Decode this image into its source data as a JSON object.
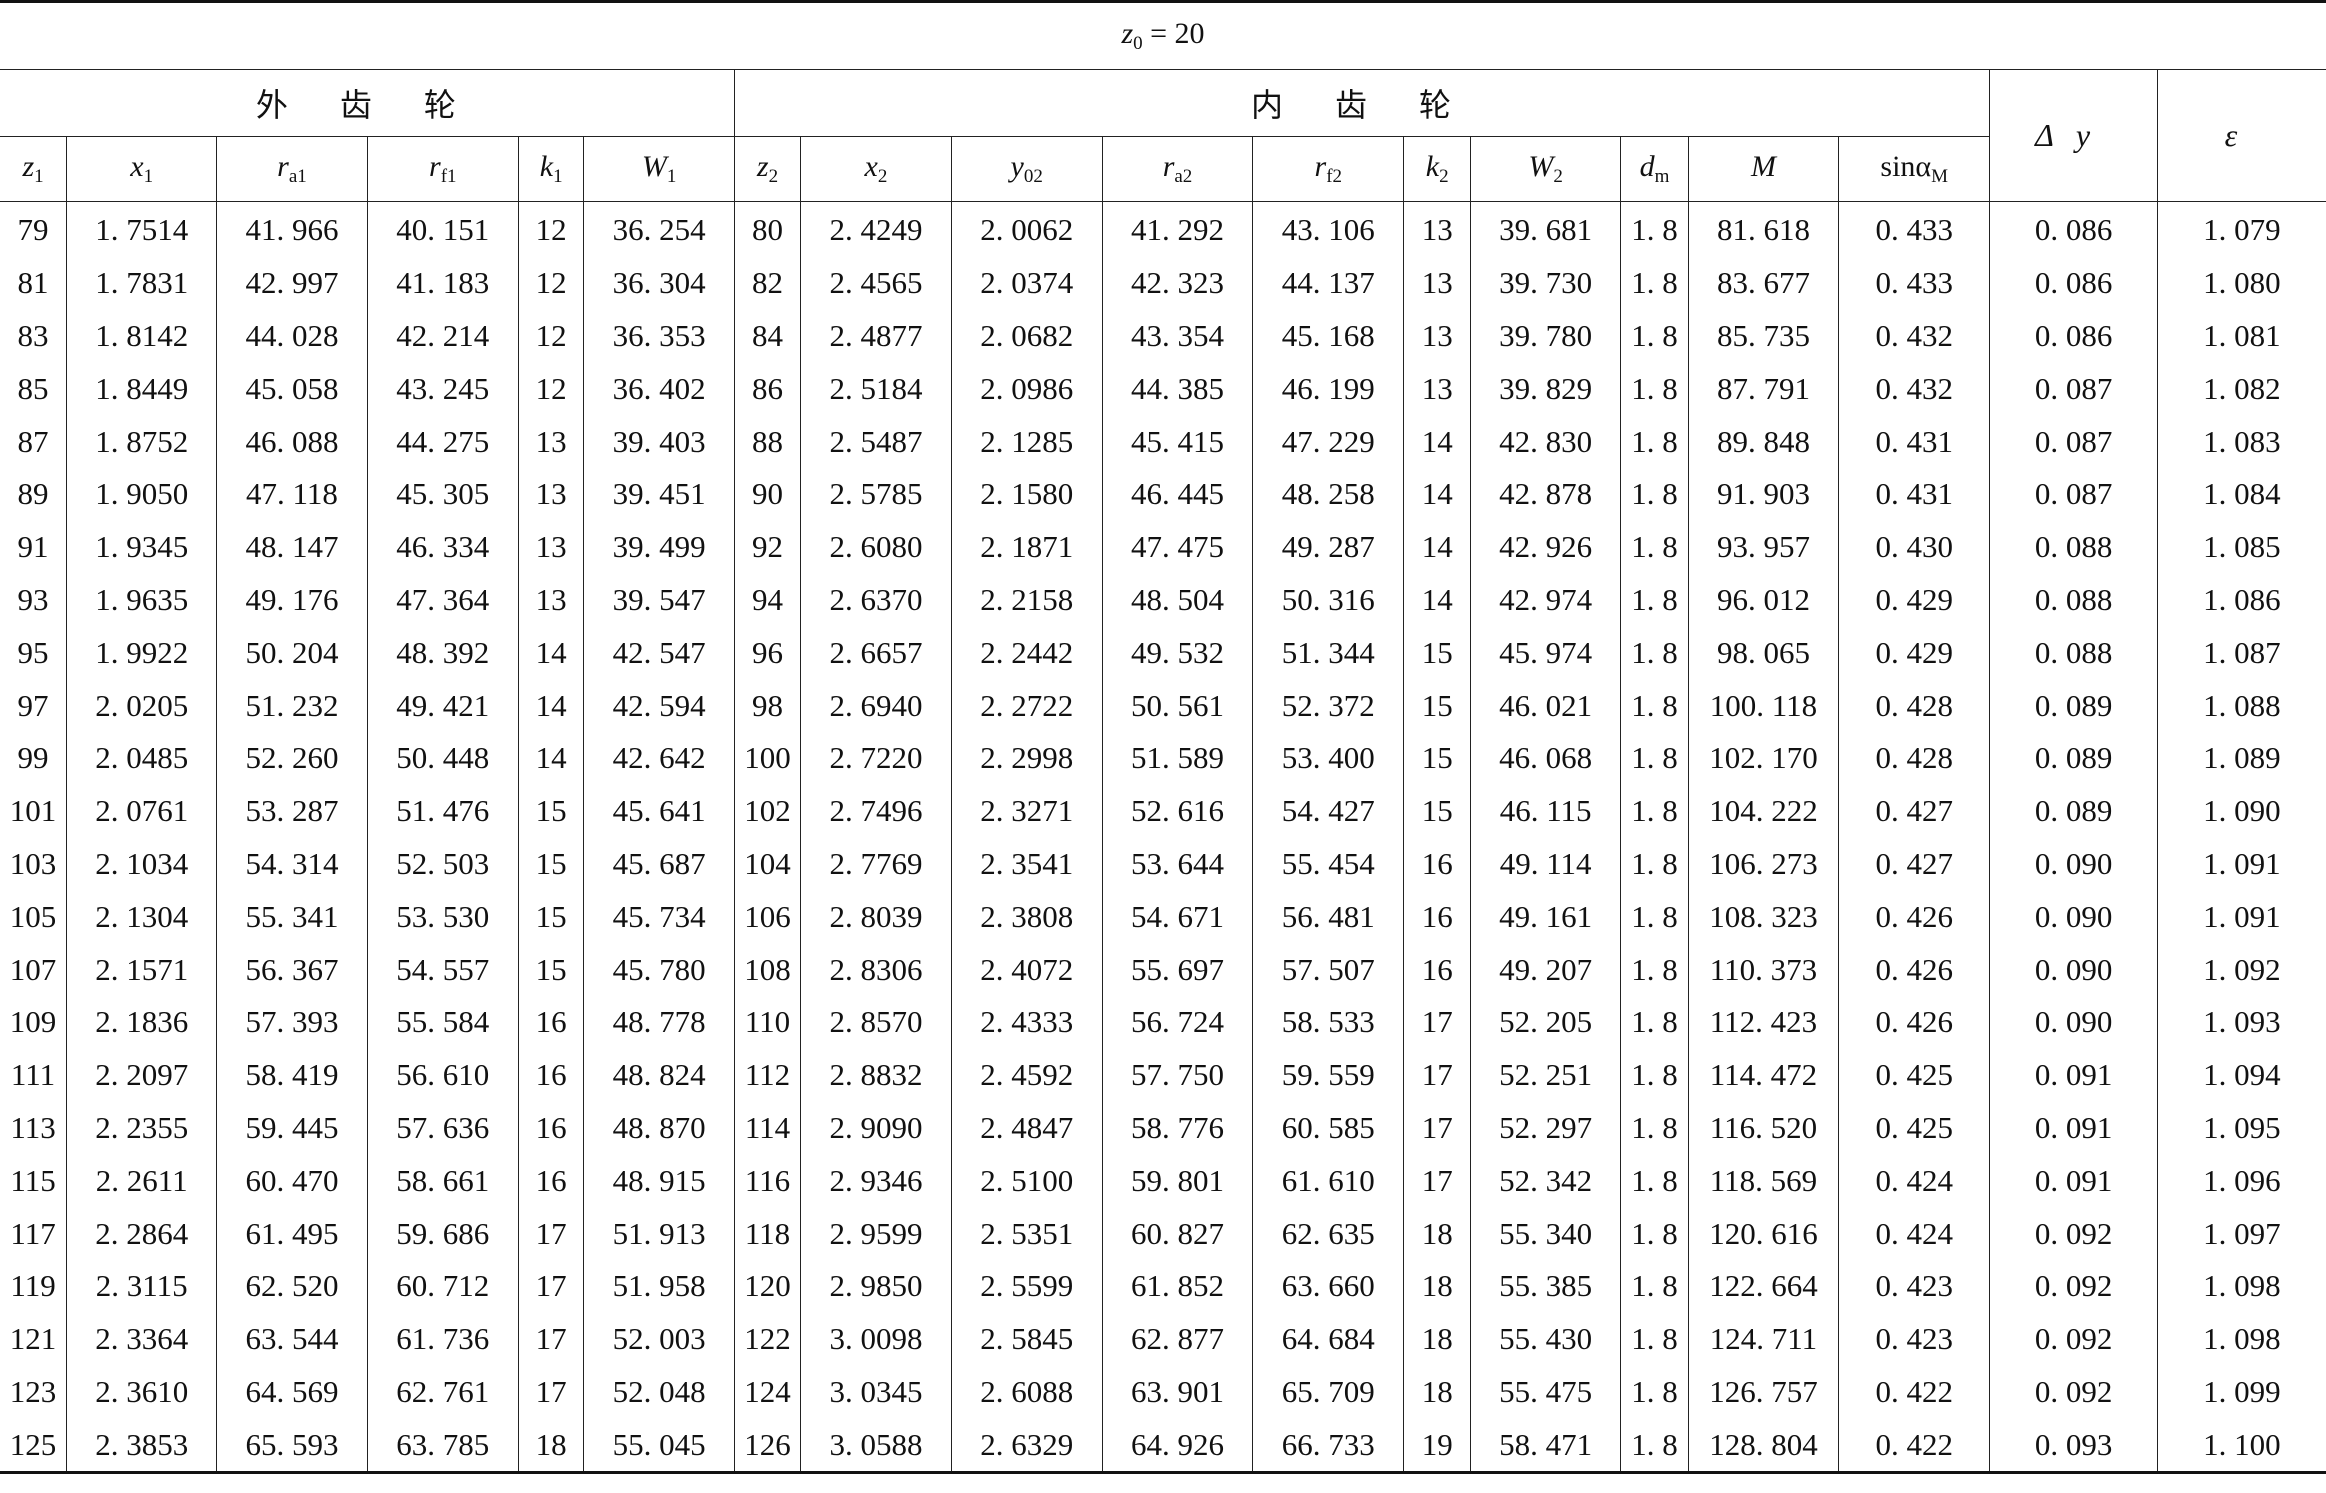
{
  "title": {
    "var": "z",
    "sub": "0",
    "rest": " = 20"
  },
  "groups": {
    "outer": "外 齿 轮",
    "inner": "内 齿 轮"
  },
  "headers": {
    "z1": {
      "base": "z",
      "sub": "1"
    },
    "x1": {
      "base": "x",
      "sub": "1"
    },
    "ra1": {
      "base": "r",
      "sub": "a1"
    },
    "rf1": {
      "base": "r",
      "sub": "f1"
    },
    "k1": {
      "base": "k",
      "sub": "1"
    },
    "W1": {
      "base": "W",
      "sub": "1"
    },
    "z2": {
      "base": "z",
      "sub": "2"
    },
    "x2": {
      "base": "x",
      "sub": "2"
    },
    "y02": {
      "base": "y",
      "sub": "02"
    },
    "ra2": {
      "base": "r",
      "sub": "a2"
    },
    "rf2": {
      "base": "r",
      "sub": "f2"
    },
    "k2": {
      "base": "k",
      "sub": "2"
    },
    "W2": {
      "base": "W",
      "sub": "2"
    },
    "dm": {
      "base": "d",
      "sub": "m"
    },
    "M": {
      "base": "M",
      "sub": ""
    },
    "sinaM": {
      "base": "sinα",
      "sub": "M"
    },
    "dy": "Δy",
    "eps": "ε"
  },
  "rows": [
    [
      "79",
      "1. 7514",
      "41. 966",
      "40. 151",
      "12",
      "36. 254",
      "80",
      "2. 4249",
      "2. 0062",
      "41. 292",
      "43. 106",
      "13",
      "39. 681",
      "1. 8",
      "81. 618",
      "0. 433",
      "0. 086",
      "1. 079"
    ],
    [
      "81",
      "1. 7831",
      "42. 997",
      "41. 183",
      "12",
      "36. 304",
      "82",
      "2. 4565",
      "2. 0374",
      "42. 323",
      "44. 137",
      "13",
      "39. 730",
      "1. 8",
      "83. 677",
      "0. 433",
      "0. 086",
      "1. 080"
    ],
    [
      "83",
      "1. 8142",
      "44. 028",
      "42. 214",
      "12",
      "36. 353",
      "84",
      "2. 4877",
      "2. 0682",
      "43. 354",
      "45. 168",
      "13",
      "39. 780",
      "1. 8",
      "85. 735",
      "0. 432",
      "0. 086",
      "1. 081"
    ],
    [
      "85",
      "1. 8449",
      "45. 058",
      "43. 245",
      "12",
      "36. 402",
      "86",
      "2. 5184",
      "2. 0986",
      "44. 385",
      "46. 199",
      "13",
      "39. 829",
      "1. 8",
      "87. 791",
      "0. 432",
      "0. 087",
      "1. 082"
    ],
    [
      "87",
      "1. 8752",
      "46. 088",
      "44. 275",
      "13",
      "39. 403",
      "88",
      "2. 5487",
      "2. 1285",
      "45. 415",
      "47. 229",
      "14",
      "42. 830",
      "1. 8",
      "89. 848",
      "0. 431",
      "0. 087",
      "1. 083"
    ],
    [
      "89",
      "1. 9050",
      "47. 118",
      "45. 305",
      "13",
      "39. 451",
      "90",
      "2. 5785",
      "2. 1580",
      "46. 445",
      "48. 258",
      "14",
      "42. 878",
      "1. 8",
      "91. 903",
      "0. 431",
      "0. 087",
      "1. 084"
    ],
    [
      "91",
      "1. 9345",
      "48. 147",
      "46. 334",
      "13",
      "39. 499",
      "92",
      "2. 6080",
      "2. 1871",
      "47. 475",
      "49. 287",
      "14",
      "42. 926",
      "1. 8",
      "93. 957",
      "0. 430",
      "0. 088",
      "1. 085"
    ],
    [
      "93",
      "1. 9635",
      "49. 176",
      "47. 364",
      "13",
      "39. 547",
      "94",
      "2. 6370",
      "2. 2158",
      "48. 504",
      "50. 316",
      "14",
      "42. 974",
      "1. 8",
      "96. 012",
      "0. 429",
      "0. 088",
      "1. 086"
    ],
    [
      "95",
      "1. 9922",
      "50. 204",
      "48. 392",
      "14",
      "42. 547",
      "96",
      "2. 6657",
      "2. 2442",
      "49. 532",
      "51. 344",
      "15",
      "45. 974",
      "1. 8",
      "98. 065",
      "0. 429",
      "0. 088",
      "1. 087"
    ],
    [
      "97",
      "2. 0205",
      "51. 232",
      "49. 421",
      "14",
      "42. 594",
      "98",
      "2. 6940",
      "2. 2722",
      "50. 561",
      "52. 372",
      "15",
      "46. 021",
      "1. 8",
      "100. 118",
      "0. 428",
      "0. 089",
      "1. 088"
    ],
    [
      "99",
      "2. 0485",
      "52. 260",
      "50. 448",
      "14",
      "42. 642",
      "100",
      "2. 7220",
      "2. 2998",
      "51. 589",
      "53. 400",
      "15",
      "46. 068",
      "1. 8",
      "102. 170",
      "0. 428",
      "0. 089",
      "1. 089"
    ],
    [
      "101",
      "2. 0761",
      "53. 287",
      "51. 476",
      "15",
      "45. 641",
      "102",
      "2. 7496",
      "2. 3271",
      "52. 616",
      "54. 427",
      "15",
      "46. 115",
      "1. 8",
      "104. 222",
      "0. 427",
      "0. 089",
      "1. 090"
    ],
    [
      "103",
      "2. 1034",
      "54. 314",
      "52. 503",
      "15",
      "45. 687",
      "104",
      "2. 7769",
      "2. 3541",
      "53. 644",
      "55. 454",
      "16",
      "49. 114",
      "1. 8",
      "106. 273",
      "0. 427",
      "0. 090",
      "1. 091"
    ],
    [
      "105",
      "2. 1304",
      "55. 341",
      "53. 530",
      "15",
      "45. 734",
      "106",
      "2. 8039",
      "2. 3808",
      "54. 671",
      "56. 481",
      "16",
      "49. 161",
      "1. 8",
      "108. 323",
      "0. 426",
      "0. 090",
      "1. 091"
    ],
    [
      "107",
      "2. 1571",
      "56. 367",
      "54. 557",
      "15",
      "45. 780",
      "108",
      "2. 8306",
      "2. 4072",
      "55. 697",
      "57. 507",
      "16",
      "49. 207",
      "1. 8",
      "110. 373",
      "0. 426",
      "0. 090",
      "1. 092"
    ],
    [
      "109",
      "2. 1836",
      "57. 393",
      "55. 584",
      "16",
      "48. 778",
      "110",
      "2. 8570",
      "2. 4333",
      "56. 724",
      "58. 533",
      "17",
      "52. 205",
      "1. 8",
      "112. 423",
      "0. 426",
      "0. 090",
      "1. 093"
    ],
    [
      "111",
      "2. 2097",
      "58. 419",
      "56. 610",
      "16",
      "48. 824",
      "112",
      "2. 8832",
      "2. 4592",
      "57. 750",
      "59. 559",
      "17",
      "52. 251",
      "1. 8",
      "114. 472",
      "0. 425",
      "0. 091",
      "1. 094"
    ],
    [
      "113",
      "2. 2355",
      "59. 445",
      "57. 636",
      "16",
      "48. 870",
      "114",
      "2. 9090",
      "2. 4847",
      "58. 776",
      "60. 585",
      "17",
      "52. 297",
      "1. 8",
      "116. 520",
      "0. 425",
      "0. 091",
      "1. 095"
    ],
    [
      "115",
      "2. 2611",
      "60. 470",
      "58. 661",
      "16",
      "48. 915",
      "116",
      "2. 9346",
      "2. 5100",
      "59. 801",
      "61. 610",
      "17",
      "52. 342",
      "1. 8",
      "118. 569",
      "0. 424",
      "0. 091",
      "1. 096"
    ],
    [
      "117",
      "2. 2864",
      "61. 495",
      "59. 686",
      "17",
      "51. 913",
      "118",
      "2. 9599",
      "2. 5351",
      "60. 827",
      "62. 635",
      "18",
      "55. 340",
      "1. 8",
      "120. 616",
      "0. 424",
      "0. 092",
      "1. 097"
    ],
    [
      "119",
      "2. 3115",
      "62. 520",
      "60. 712",
      "17",
      "51. 958",
      "120",
      "2. 9850",
      "2. 5599",
      "61. 852",
      "63. 660",
      "18",
      "55. 385",
      "1. 8",
      "122. 664",
      "0. 423",
      "0. 092",
      "1. 098"
    ],
    [
      "121",
      "2. 3364",
      "63. 544",
      "61. 736",
      "17",
      "52. 003",
      "122",
      "3. 0098",
      "2. 5845",
      "62. 877",
      "64. 684",
      "18",
      "55. 430",
      "1. 8",
      "124. 711",
      "0. 423",
      "0. 092",
      "1. 098"
    ],
    [
      "123",
      "2. 3610",
      "64. 569",
      "62. 761",
      "17",
      "52. 048",
      "124",
      "3. 0345",
      "2. 6088",
      "63. 901",
      "65. 709",
      "18",
      "55. 475",
      "1. 8",
      "126. 757",
      "0. 422",
      "0. 092",
      "1. 099"
    ],
    [
      "125",
      "2. 3853",
      "65. 593",
      "63. 785",
      "18",
      "55. 045",
      "126",
      "3. 0588",
      "2. 6329",
      "64. 926",
      "66. 733",
      "19",
      "58. 471",
      "1. 8",
      "128. 804",
      "0. 422",
      "0. 093",
      "1. 100"
    ]
  ]
}
